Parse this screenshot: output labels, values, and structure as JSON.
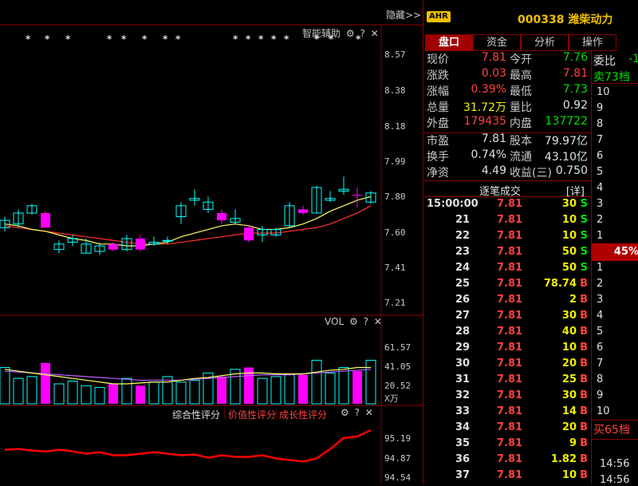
{
  "chart": {
    "hide_label": "隐藏>>",
    "kline_panel_title": "智能辅助",
    "kline_axis": [
      "8.57",
      "8.38",
      "8.18",
      "7.99",
      "7.80",
      "7.60",
      "7.41",
      "7.21"
    ],
    "vol_panel_title": "VOL",
    "vol_axis": [
      "61.57",
      "41.05",
      "20.52"
    ],
    "vol_unit": "X万",
    "score_tabs": [
      "综合性评分",
      "价值性评分",
      "成长性评分"
    ],
    "score_axis": [
      "95.19",
      "94.87",
      "94.54"
    ],
    "star_glyph": "*",
    "gear_glyph": "⚙",
    "help_glyph": "?",
    "close_glyph": "✕",
    "colors": {
      "up": "#ff00ff",
      "down": "#00ffff",
      "ma5": "#ffff66",
      "ma10": "#ff3030",
      "score": "#ff0000",
      "grid": "#8b0000"
    }
  },
  "chart_data": {
    "type": "candlestick",
    "candles": [
      [
        7.66,
        7.62,
        7.68,
        7.6,
        "down"
      ],
      [
        7.64,
        7.7,
        7.72,
        7.62,
        "down"
      ],
      [
        7.7,
        7.74,
        7.75,
        7.69,
        "down"
      ],
      [
        7.7,
        7.62,
        7.71,
        7.62,
        "up"
      ],
      [
        7.53,
        7.5,
        7.55,
        7.48,
        "down"
      ],
      [
        7.56,
        7.54,
        7.58,
        7.52,
        "down"
      ],
      [
        7.53,
        7.48,
        7.56,
        7.48,
        "down"
      ],
      [
        7.52,
        7.49,
        7.54,
        7.47,
        "down"
      ],
      [
        7.5,
        7.53,
        7.54,
        7.49,
        "up"
      ],
      [
        7.5,
        7.56,
        7.58,
        7.49,
        "down"
      ],
      [
        7.56,
        7.5,
        7.58,
        7.49,
        "up"
      ],
      [
        7.53,
        7.54,
        7.57,
        7.52,
        "down"
      ],
      [
        7.55,
        7.55,
        7.57,
        7.53,
        "down"
      ],
      [
        7.68,
        7.74,
        7.76,
        7.64,
        "down"
      ],
      [
        7.77,
        7.78,
        7.83,
        7.74,
        "down"
      ],
      [
        7.72,
        7.76,
        7.79,
        7.7,
        "down"
      ],
      [
        7.7,
        7.66,
        7.72,
        7.64,
        "up"
      ],
      [
        7.65,
        7.67,
        7.72,
        7.64,
        "down"
      ],
      [
        7.62,
        7.55,
        7.63,
        7.54,
        "up"
      ],
      [
        7.58,
        7.61,
        7.63,
        7.54,
        "down"
      ],
      [
        7.58,
        7.61,
        7.62,
        7.57,
        "down"
      ],
      [
        7.63,
        7.74,
        7.76,
        7.62,
        "down"
      ],
      [
        7.72,
        7.7,
        7.74,
        7.69,
        "up"
      ],
      [
        7.7,
        7.84,
        7.85,
        7.7,
        "down"
      ],
      [
        7.77,
        7.78,
        7.82,
        7.76,
        "down"
      ],
      [
        7.82,
        7.83,
        7.9,
        7.8,
        "down"
      ],
      [
        7.8,
        7.8,
        7.84,
        7.73,
        "up"
      ],
      [
        7.76,
        7.81,
        7.82,
        7.75,
        "down"
      ]
    ],
    "ma5": [
      7.64,
      7.63,
      7.61,
      7.6,
      7.58,
      7.56,
      7.55,
      7.53,
      7.53,
      7.52,
      7.52,
      7.53,
      7.54,
      7.57,
      7.59,
      7.61,
      7.63,
      7.64,
      7.63,
      7.61,
      7.61,
      7.62,
      7.64,
      7.67,
      7.71,
      7.74,
      7.77,
      7.79
    ],
    "ma10": [
      7.63,
      7.62,
      7.61,
      7.6,
      7.59,
      7.58,
      7.57,
      7.56,
      7.55,
      7.54,
      7.53,
      7.53,
      7.53,
      7.54,
      7.55,
      7.56,
      7.57,
      7.58,
      7.59,
      7.59,
      7.59,
      7.6,
      7.61,
      7.62,
      7.64,
      7.67,
      7.7,
      7.74
    ],
    "volumes": [
      40,
      28,
      30,
      45,
      22,
      25,
      20,
      18,
      22,
      28,
      20,
      24,
      30,
      24,
      26,
      34,
      30,
      38,
      40,
      28,
      30,
      32,
      32,
      48,
      34,
      40,
      36,
      48
    ],
    "vol_ma5": [
      38,
      36,
      34,
      32,
      30,
      28,
      26,
      24,
      22,
      22,
      23,
      24,
      24,
      26,
      28,
      29,
      31,
      33,
      34,
      34,
      33,
      33,
      33,
      35,
      37,
      38,
      40,
      40
    ],
    "vol_ma10": [
      36,
      35,
      34,
      33,
      32,
      31,
      30,
      29,
      28,
      27,
      26,
      26,
      26,
      26,
      27,
      28,
      29,
      30,
      31,
      32,
      32,
      32,
      33,
      34,
      35,
      36,
      37,
      38
    ],
    "scores": [
      94.95,
      94.96,
      94.94,
      94.93,
      94.95,
      94.93,
      94.9,
      94.92,
      94.88,
      94.88,
      94.9,
      94.92,
      94.9,
      94.88,
      94.89,
      94.85,
      94.88,
      94.86,
      94.86,
      94.88,
      94.84,
      94.82,
      94.8,
      94.84,
      94.96,
      95.1,
      95.12,
      95.2
    ],
    "ylim": [
      7.21,
      8.57
    ],
    "vol_ylim": [
      0,
      61.57
    ],
    "score_ylim": [
      94.54,
      95.19
    ]
  },
  "stock": {
    "badge": "AHR",
    "code_name": "000338 潍柴动力"
  },
  "tabs": [
    "盘口",
    "资金",
    "分析",
    "操作"
  ],
  "quote": [
    {
      "l1": "现价",
      "v1": "7.81",
      "c1": "red",
      "l2": "今开",
      "v2": "7.76",
      "c2": "green"
    },
    {
      "l1": "涨跌",
      "v1": "0.03",
      "c1": "red",
      "l2": "最高",
      "v2": "7.81",
      "c2": "red"
    },
    {
      "l1": "涨幅",
      "v1": "0.39%",
      "c1": "red",
      "l2": "最低",
      "v2": "7.73",
      "c2": "green"
    },
    {
      "l1": "总量",
      "v1": "31.72万",
      "c1": "yellow",
      "l2": "量比",
      "v2": "0.92",
      "c2": "white"
    },
    {
      "l1": "外盘",
      "v1": "179435",
      "c1": "red",
      "l2": "内盘",
      "v2": "137722",
      "c2": "green"
    },
    {
      "l1": "市盈",
      "v1": "7.81",
      "c1": "white",
      "l2": "股本",
      "v2": "79.97亿",
      "c2": "white"
    },
    {
      "l1": "换手",
      "v1": "0.74%",
      "c1": "white",
      "l2": "流通",
      "v2": "43.10亿",
      "c2": "white"
    },
    {
      "l1": "净资",
      "v1": "4.49",
      "c1": "white",
      "l2": "收益(三)",
      "v2": "0.750",
      "c2": "white"
    }
  ],
  "trades_title": "逐笔成交",
  "trades_detail": "[详]",
  "trades": [
    {
      "t": "15:00:00",
      "p": "7.81",
      "v": "30",
      "bs": "S"
    },
    {
      "t": "21",
      "p": "7.81",
      "v": "10",
      "bs": "S"
    },
    {
      "t": "22",
      "p": "7.81",
      "v": "10",
      "bs": "S"
    },
    {
      "t": "23",
      "p": "7.81",
      "v": "50",
      "bs": "S"
    },
    {
      "t": "24",
      "p": "7.81",
      "v": "50",
      "bs": "S"
    },
    {
      "t": "25",
      "p": "7.81",
      "v": "78.74",
      "bs": "B"
    },
    {
      "t": "26",
      "p": "7.81",
      "v": "2",
      "bs": "B"
    },
    {
      "t": "27",
      "p": "7.81",
      "v": "30",
      "bs": "B"
    },
    {
      "t": "28",
      "p": "7.81",
      "v": "40",
      "bs": "B"
    },
    {
      "t": "29",
      "p": "7.81",
      "v": "10",
      "bs": "B"
    },
    {
      "t": "30",
      "p": "7.81",
      "v": "20",
      "bs": "B"
    },
    {
      "t": "31",
      "p": "7.81",
      "v": "25",
      "bs": "B"
    },
    {
      "t": "32",
      "p": "7.81",
      "v": "30",
      "bs": "B"
    },
    {
      "t": "33",
      "p": "7.81",
      "v": "14",
      "bs": "B"
    },
    {
      "t": "34",
      "p": "7.81",
      "v": "20",
      "bs": "B"
    },
    {
      "t": "35",
      "p": "7.81",
      "v": "9",
      "bs": "B"
    },
    {
      "t": "36",
      "p": "7.81",
      "v": "1.82",
      "bs": "B"
    },
    {
      "t": "37",
      "p": "7.81",
      "v": "10",
      "bs": "B"
    }
  ],
  "depth": {
    "weibi_label": "委比",
    "weibi_value": "-1",
    "sell_label": "卖73档",
    "sell_levels": [
      "10",
      "9",
      "8",
      "7",
      "6",
      "5",
      "4",
      "3",
      "2",
      "1"
    ],
    "ratio": "45%",
    "buy_levels": [
      "1",
      "2",
      "3",
      "4",
      "5",
      "6",
      "7",
      "8",
      "9",
      "10"
    ],
    "buy_label": "买65档",
    "times": [
      "14:56",
      "14:56"
    ]
  }
}
